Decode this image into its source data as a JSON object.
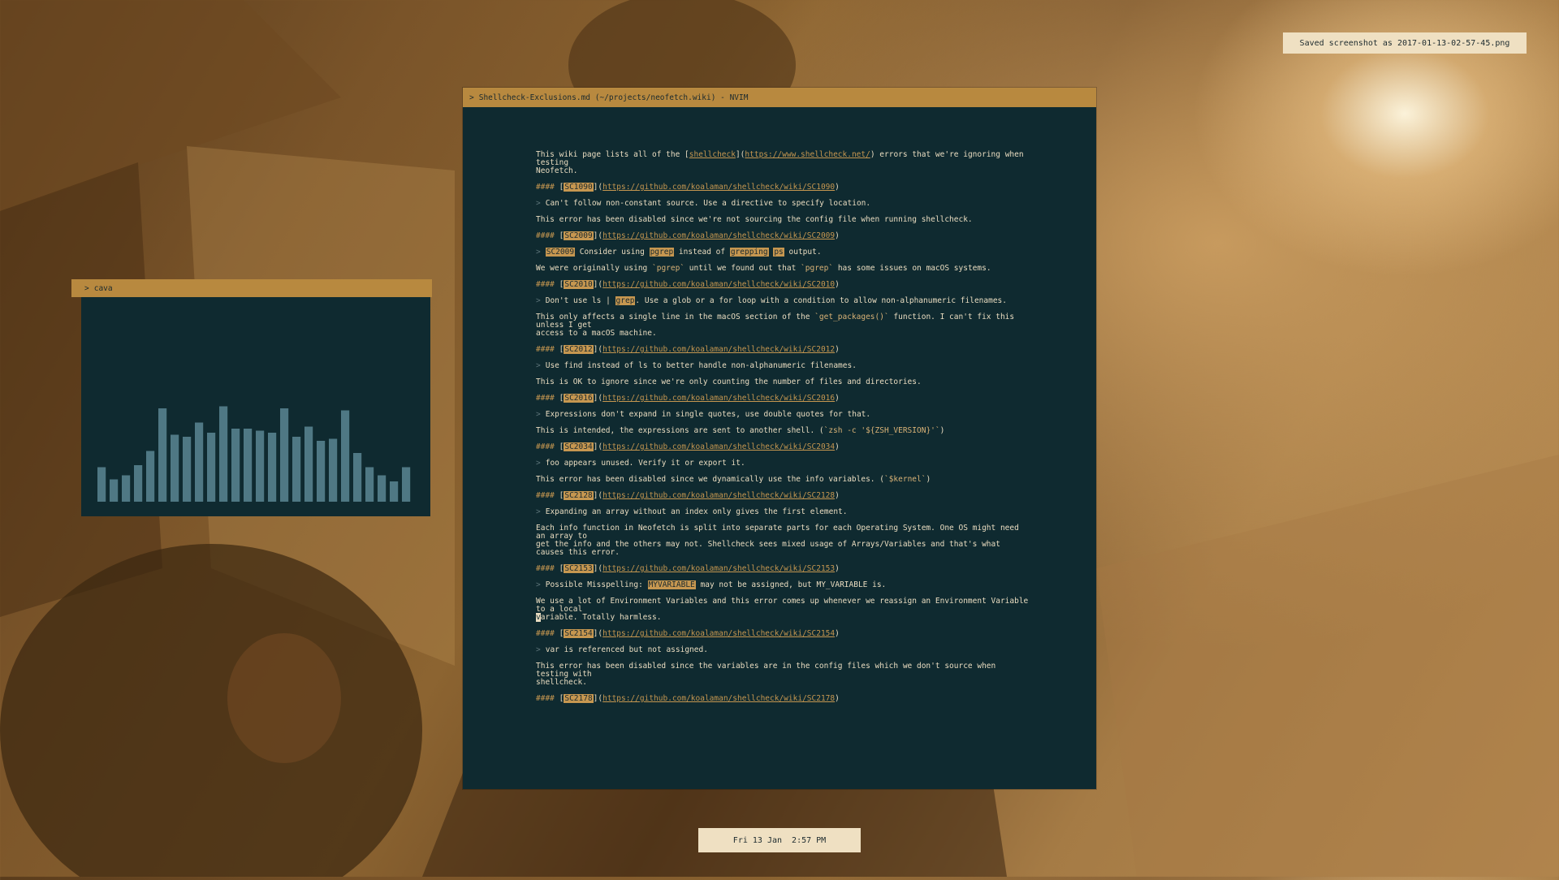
{
  "notification": {
    "text": "Saved screenshot as 2017-01-13-02-57-45.png"
  },
  "editor": {
    "title_chevron": ">",
    "title": "Shellcheck-Exclusions.md (~/projects/neofetch.wiki) - NVIM",
    "intro": [
      "This wiki page lists all of the [",
      "shellcheck",
      "](",
      "https://www.shellcheck.net/",
      ") errors that we're ignoring when testing",
      "Neofetch."
    ],
    "heading_mark": "####",
    "sections": [
      {
        "code": "SC1090",
        "url": "https://github.com/koalaman/shellcheck/wiki/SC1090",
        "quote": "Can't follow non-constant source. Use a directive to specify location.",
        "desc": [
          "This error has been disabled since we're not sourcing the config file when running shellcheck."
        ]
      },
      {
        "code": "SC2009",
        "url": "https://github.com/koalaman/shellcheck/wiki/SC2009",
        "quote_parts": [
          "SC2009",
          " Consider using ",
          "pgrep",
          " instead of ",
          "grepping",
          " ",
          "ps",
          " output."
        ],
        "desc_parts": [
          "We were originally using ",
          "`pgrep`",
          " until we found out that ",
          "`pgrep`",
          " has some issues on macOS systems."
        ]
      },
      {
        "code": "SC2010",
        "url": "https://github.com/koalaman/shellcheck/wiki/SC2010",
        "quote_parts": [
          "Don't use ls | ",
          "grep",
          ". Use a glob or a for loop with a condition to allow non-alphanumeric filenames."
        ],
        "desc_parts": [
          "This only affects a single line in the macOS section of the ",
          "`get_packages()`",
          " function. I can't fix this unless I get"
        ],
        "desc2": "access to a macOS machine."
      },
      {
        "code": "SC2012",
        "url": "https://github.com/koalaman/shellcheck/wiki/SC2012",
        "quote": "Use find instead of ls to better handle non-alphanumeric filenames.",
        "desc": [
          "This is OK to ignore since we're only counting the number of files and directories."
        ]
      },
      {
        "code": "SC2016",
        "url": "https://github.com/koalaman/shellcheck/wiki/SC2016",
        "quote": "Expressions don't expand in single quotes, use double quotes for that.",
        "desc_parts": [
          "This is intended, the expressions are sent to another shell. (",
          "`zsh -c '${ZSH_VERSION}'`",
          ")"
        ]
      },
      {
        "code": "SC2034",
        "url": "https://github.com/koalaman/shellcheck/wiki/SC2034",
        "quote": "foo appears unused. Verify it or export it.",
        "desc_parts": [
          "This error has been disabled since we dynamically use the info variables. (",
          "`$kernel`",
          ")"
        ]
      },
      {
        "code": "SC2128",
        "url": "https://github.com/koalaman/shellcheck/wiki/SC2128",
        "quote": "Expanding an array without an index only gives the first element.",
        "desc": [
          "Each info function in Neofetch is split into separate parts for each Operating System. One OS might need an array to",
          "get the info and the others may not. Shellcheck sees mixed usage of Arrays/Variables and that's what causes this error."
        ]
      },
      {
        "code": "SC2153",
        "url": "https://github.com/koalaman/shellcheck/wiki/SC2153",
        "quote_parts": [
          "Possible Misspelling: ",
          "MYVARIABLE",
          " may not be assigned, but MY_VARIABLE is."
        ],
        "desc": [
          "We use a lot of Environment Variables and this error comes up whenever we reassign an Environment Variable to a local",
          "variable. Totally harmless."
        ]
      },
      {
        "code": "SC2154",
        "url": "https://github.com/koalaman/shellcheck/wiki/SC2154",
        "quote": "var is referenced but not assigned.",
        "desc": [
          "This error has been disabled since the variables are in the config files which we don't source when testing with",
          "shellcheck."
        ]
      },
      {
        "code": "SC2178",
        "url": "https://github.com/koalaman/shellcheck/wiki/SC2178"
      }
    ]
  },
  "cava": {
    "title_chevron": ">",
    "title": "cava",
    "bar_color": "#4f7884",
    "bars": [
      0.17,
      0.11,
      0.13,
      0.18,
      0.25,
      0.46,
      0.33,
      0.32,
      0.39,
      0.34,
      0.47,
      0.36,
      0.36,
      0.35,
      0.34,
      0.46,
      0.32,
      0.37,
      0.3,
      0.31,
      0.45,
      0.24,
      0.17,
      0.13,
      0.1,
      0.17
    ]
  },
  "datebar": {
    "text": "Fri 13 Jan  2:57 PM"
  },
  "colors": {
    "accent": "#b8893f",
    "panel_bg": "#0f2a30",
    "text": "#e9dcc0",
    "notify_bg": "#efe0c2"
  },
  "icons": [
    "chevron-right-icon"
  ]
}
